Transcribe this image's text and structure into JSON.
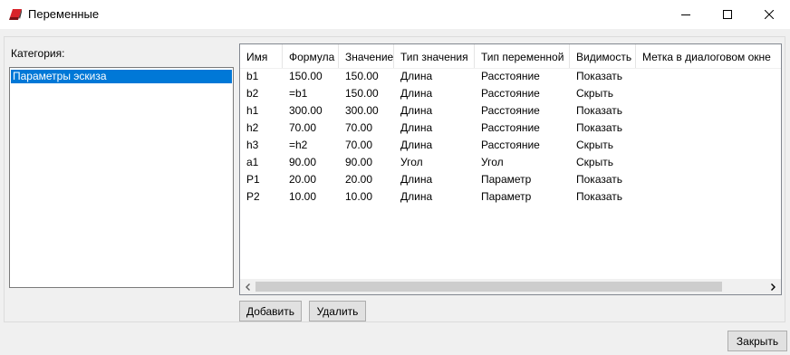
{
  "window": {
    "title": "Переменные",
    "icon": "app-icon",
    "controls": [
      "minimize-icon",
      "maximize-icon",
      "close-icon"
    ]
  },
  "category": {
    "label": "Категория:",
    "items": [
      {
        "label": "Параметры эскиза",
        "selected": true
      }
    ]
  },
  "table": {
    "columns": [
      "Имя",
      "Формула",
      "Значение",
      "Тип значения",
      "Тип переменной",
      "Видимость",
      "Метка в диалоговом окне"
    ],
    "rows": [
      [
        "b1",
        "150.00",
        "150.00",
        "Длина",
        "Расстояние",
        "Показать",
        ""
      ],
      [
        "b2",
        "=b1",
        "150.00",
        "Длина",
        "Расстояние",
        "Скрыть",
        ""
      ],
      [
        "h1",
        "300.00",
        "300.00",
        "Длина",
        "Расстояние",
        "Показать",
        ""
      ],
      [
        "h2",
        "70.00",
        "70.00",
        "Длина",
        "Расстояние",
        "Показать",
        ""
      ],
      [
        "h3",
        "=h2",
        "70.00",
        "Длина",
        "Расстояние",
        "Скрыть",
        ""
      ],
      [
        "a1",
        "90.00",
        "90.00",
        "Угол",
        "Угол",
        "Скрыть",
        ""
      ],
      [
        "P1",
        "20.00",
        "20.00",
        "Длина",
        "Параметр",
        "Показать",
        ""
      ],
      [
        "P2",
        "10.00",
        "10.00",
        "Длина",
        "Параметр",
        "Показать",
        ""
      ]
    ]
  },
  "buttons": {
    "add": "Добавить",
    "delete": "Удалить",
    "close": "Закрыть"
  },
  "colors": {
    "selection": "#0078d7",
    "app_icon": "#d9232a"
  }
}
